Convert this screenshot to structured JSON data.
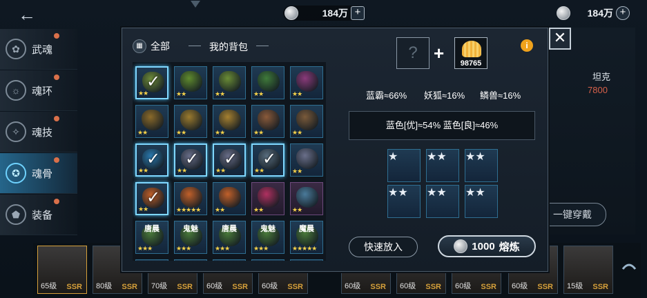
{
  "top_bar": {
    "back_icon": "arrow-left-icon",
    "currency_center": {
      "icon": "silver-coin-icon",
      "value": "184万"
    },
    "currency_right": {
      "icon": "silver-coin-icon",
      "value": "184万"
    }
  },
  "nav": {
    "items": [
      {
        "label": "武魂",
        "icon": "martial-soul-icon",
        "active": false
      },
      {
        "label": "魂环",
        "icon": "soul-ring-icon",
        "active": false
      },
      {
        "label": "魂技",
        "icon": "soul-skill-icon",
        "active": false
      },
      {
        "label": "魂骨",
        "icon": "soul-bone-icon",
        "active": true
      },
      {
        "label": "装备",
        "icon": "equipment-icon",
        "active": false
      }
    ]
  },
  "background": {
    "right_label": "坦克",
    "right_value": "7800",
    "one_key_button": "一键穿戴",
    "heroes": [
      {
        "level": "65级",
        "rarity": "SSR"
      },
      {
        "level": "80级",
        "rarity": "SSR"
      },
      {
        "level": "70级",
        "rarity": "SSR"
      },
      {
        "level": "60级",
        "rarity": "SSR"
      },
      {
        "level": "60级",
        "rarity": "SSR"
      },
      {
        "level": "60级",
        "rarity": "SSR"
      },
      {
        "level": "60级",
        "rarity": "SSR"
      },
      {
        "level": "60级",
        "rarity": "SSR"
      },
      {
        "level": "60级",
        "rarity": "SSR"
      },
      {
        "level": "15级",
        "rarity": "SSR"
      }
    ]
  },
  "modal": {
    "filter_label": "全部",
    "bag_title": "我的背包",
    "close_icon": "close-icon",
    "grid": [
      [
        {
          "s": 2,
          "sel": true,
          "c": "#6e8c3a"
        },
        {
          "s": 2,
          "c": "#5f8a2e"
        },
        {
          "s": 2,
          "c": "#6a8c36"
        },
        {
          "s": 2,
          "c": "#3f7a3a"
        },
        {
          "s": 2,
          "c": "#8a3a7a"
        }
      ],
      [
        {
          "s": 2,
          "c": "#8a6a2a"
        },
        {
          "s": 2,
          "c": "#9a7a2e"
        },
        {
          "s": 2,
          "c": "#a58030"
        },
        {
          "s": 2,
          "c": "#8a5a3a"
        },
        {
          "s": 2,
          "c": "#7a5a3a"
        }
      ],
      [
        {
          "s": 2,
          "sel": true,
          "c": "#2a7ab0"
        },
        {
          "s": 2,
          "sel": true,
          "c": "#6a6f8a"
        },
        {
          "s": 2,
          "sel": true,
          "c": "#6a6f8a"
        },
        {
          "s": 2,
          "sel": true,
          "c": "#5a6f80"
        },
        {
          "s": 2,
          "c": "#6a6f8a"
        }
      ],
      [
        {
          "s": 2,
          "sel": true,
          "c": "#c0602a"
        },
        {
          "s": 5,
          "c": "#c0602a"
        },
        {
          "s": 2,
          "c": "#c0602a"
        },
        {
          "s": 2,
          "purple": true,
          "c": "#b03060"
        },
        {
          "s": 2,
          "purple": true,
          "c": "#4a7a9a"
        }
      ],
      [
        {
          "s": 3,
          "name": "唐晨",
          "c": "#4a7a3a"
        },
        {
          "s": 3,
          "name": "鬼魅",
          "c": "#4a7a3a"
        },
        {
          "s": 3,
          "name": "唐晨",
          "c": "#4a7a3a"
        },
        {
          "s": 3,
          "name": "鬼魅",
          "c": "#4a7a3a"
        },
        {
          "s": 5,
          "name": "魔晨",
          "c": "#4a7a3a"
        }
      ]
    ],
    "input_placeholder": "?",
    "material": {
      "icon": "golden-shell-icon",
      "count": "98765"
    },
    "info_icon": "info-icon",
    "probabilities": [
      "蓝霸≈66%",
      "妖狐≈16%",
      "鳞兽≈16%"
    ],
    "quality_result": "蓝色[优]≈54%  蓝色[良]≈46%",
    "selected": [
      {
        "s": 1,
        "c": "#6a6f8a"
      },
      {
        "s": 2,
        "c": "#6a6f8a"
      },
      {
        "s": 2,
        "c": "#3f7a3a"
      },
      {
        "s": 2,
        "c": "#2a7ab0"
      },
      {
        "s": 2,
        "c": "#5a6f80"
      },
      {
        "s": 2,
        "c": "#c0602a"
      }
    ],
    "quick_put_button": "快速放入",
    "smelt_cost": "1000",
    "smelt_label": "熔炼"
  }
}
